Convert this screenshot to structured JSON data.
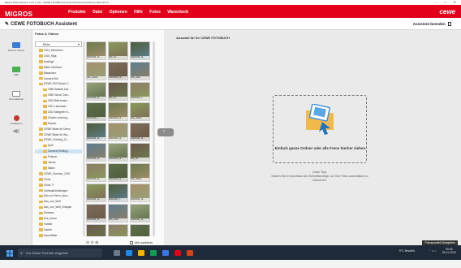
{
  "window": {
    "title": "Migros Photo Service 7.2.5 (x 64) - CEWE FOTOBUCH Gross Panorama Hardcover Matt (26 S)",
    "controls": [
      "–",
      "□",
      "✕"
    ]
  },
  "brand": {
    "logo_main": "MIGROS",
    "logo_sub": "PHOTO SERVICE",
    "menu": [
      "Produkte",
      "Datei",
      "Optionen",
      "Hilfe",
      "Fotos",
      "Warenkorb"
    ],
    "partner": "cewe",
    "color": "#e3001b"
  },
  "assistant": {
    "title": "CEWE FOTOBUCH Assistent",
    "exit_label": "Assistent beenden"
  },
  "sidebar": {
    "items": [
      {
        "label": "Fotos & Videos",
        "icon": "photos-videos-icon",
        "color": "#3a7bd5"
      },
      {
        "label": "Hilfe",
        "icon": "help-icon",
        "color": "#4caf50"
      },
      {
        "label": "Informationen",
        "icon": "info-icon",
        "color": "#888888"
      },
      {
        "label": "Landkarten",
        "icon": "map-icon",
        "color": "#c0392b"
      }
    ],
    "collapse_icon": "double-chevron-left-icon",
    "collapse_glyph": "≪"
  },
  "browser": {
    "label": "Fotos & Videos",
    "folder_select": "Bilder",
    "tree": [
      "2014_Menschen",
      "2016_Riga",
      "Ausflüge",
      "Bilder mit Rand",
      "Basashorn",
      "Camera Roll",
      "CEWE 2022 Album 2...",
      "1986 Seltsies bas...",
      "1989 Vat de Cam...",
      "2000 Bitte bearb...",
      "2021 Lammarer...",
      "2022 Maegreth N...",
      "Closeto cola eng...",
      "Depoto",
      "CEWE Bilder für Demo",
      "CEWE Bilder für Wa...",
      "CEWE_Frühling_21...",
      "April",
      "Camera Frühling...",
      "Februar",
      "Januar",
      "Maerz",
      "CEWE_Sommer_2020",
      "China",
      "China ??",
      "CriellsalleUnterlagen",
      "Das von Herrn_Ama...",
      "Das_von_Wolf",
      "Das_von_Wolf_Entspan",
      "Diverses",
      "Ens_Drone",
      "Familie",
      "Garten",
      "Hans Bilder"
    ],
    "selected_index": 18,
    "thumb_labels": [
      "20220306_14...",
      "IMG_20...",
      "20220306_14...",
      "IMG_20220...",
      "20220306_14...",
      "IMG_2022...",
      "20220306_14...",
      "IMG_20...",
      "20220306_1...",
      "20220306_1...",
      "20220306_14...",
      "IMG_20220...",
      "20220306_14...",
      "20220306_14...",
      "20220306_14...",
      "20220306_14...",
      "20220306_14...",
      "IMG_20...",
      "20220306_14...",
      "20220306_14...",
      "IMG_20220...",
      "20220306_14...",
      "20220306_1...",
      "20220306_14...",
      "20220306_14...",
      "IMG_2022...",
      "20220306_14...",
      "20220306_14...",
      "20220306_14...",
      "20220306_14..."
    ],
    "zoom_icons": [
      "zoom-out-icon",
      "zoom-reset-icon",
      "zoom-in-icon"
    ],
    "zoom_glyphs": "⊖ ⊙ ⊕",
    "mark_all": "Alle markieren"
  },
  "selection": {
    "label": "Auswahl für Ihr CEWE FOTOBUCH",
    "drop_title": "Einfach ganze Ordner oder alle Fotos hierher ziehen.",
    "tip_title": "Unser Tipp:",
    "tip_text": "Nutzen Sie im Anschluss den Schnellanzeiger, um Ihre Fotos automatisch zu reduzieren."
  },
  "taskbar": {
    "search_placeholder": "Zur Suche Text hier eingeben",
    "weather": "9°C Bewölkt",
    "time": "09:52",
    "date": "05.11.2022",
    "tooltip": "Fotoauswahl übergeben"
  }
}
